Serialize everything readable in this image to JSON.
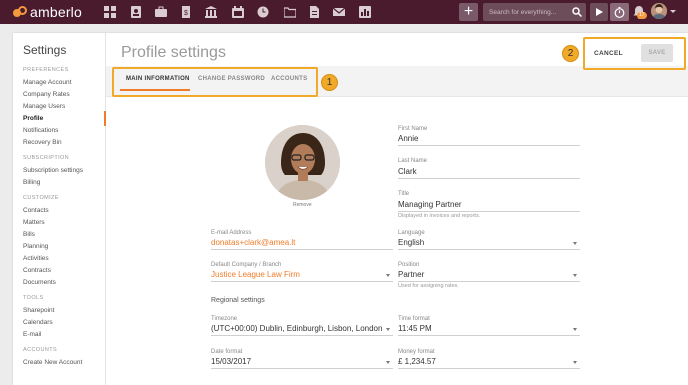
{
  "app": {
    "name": "amberlo"
  },
  "topbar": {
    "nav_icons": [
      "dashboard-icon",
      "contacts-icon",
      "matters-icon",
      "bills-icon",
      "bank-icon",
      "calendar-icon",
      "time-history-icon",
      "folder-icon",
      "documents-icon",
      "mail-icon",
      "reports-icon"
    ],
    "plus_label": "+",
    "search_placeholder": "Search for everything...",
    "notification_count": "17"
  },
  "sidebar": {
    "title": "Settings",
    "sections": [
      {
        "heading": "PREFERENCES",
        "items": [
          "Manage Account",
          "Company Rates",
          "Manage Users",
          "Profile",
          "Notifications",
          "Recovery Bin"
        ]
      },
      {
        "heading": "SUBSCRIPTION",
        "items": [
          "Subscription settings",
          "Billing"
        ]
      },
      {
        "heading": "CUSTOMIZE",
        "items": [
          "Contacts",
          "Matters",
          "Bills",
          "Planning",
          "Activities",
          "Contracts",
          "Documents"
        ]
      },
      {
        "heading": "TOOLS",
        "items": [
          "Sharepoint",
          "Calendars",
          "E-mail"
        ]
      },
      {
        "heading": "ACCOUNTS",
        "items": [
          "Create New Account"
        ]
      }
    ],
    "active_item": "Profile"
  },
  "header": {
    "title": "Profile settings",
    "cancel_label": "CANCEL",
    "save_label": "SAVE"
  },
  "tabs": [
    {
      "label": "MAIN INFORMATION",
      "active": true
    },
    {
      "label": "CHANGE PASSWORD",
      "active": false
    },
    {
      "label": "ACCOUNTS",
      "active": false
    }
  ],
  "callouts": [
    "1",
    "2"
  ],
  "profile": {
    "remove_label": "Remove",
    "first_name": {
      "label": "First Name",
      "value": "Annie"
    },
    "last_name": {
      "label": "Last Name",
      "value": "Clark"
    },
    "title": {
      "label": "Title",
      "value": "Managing Partner",
      "hint": "Displayed in invoices and reports."
    },
    "email": {
      "label": "E-mail Address",
      "value": "donatas+clark@amea.lt"
    },
    "language": {
      "label": "Language",
      "value": "English"
    },
    "default_company": {
      "label": "Default Company / Branch",
      "value": "Justice League Law Firm"
    },
    "position": {
      "label": "Position",
      "value": "Partner",
      "hint": "Used for assigning rates."
    }
  },
  "regional": {
    "heading": "Regional settings",
    "timezone": {
      "label": "Timezone",
      "value": "(UTC+00:00) Dublin, Edinburgh, Lisbon, London"
    },
    "time_format": {
      "label": "Time format",
      "value": "11:45 PM"
    },
    "date_format": {
      "label": "Date format",
      "value": "15/03/2017"
    },
    "money_format": {
      "label": "Money format",
      "value": "£ 1,234.57"
    }
  },
  "colors": {
    "topbar": "#4a1b2c",
    "accent": "#f07c2a",
    "callout": "#f0a928"
  }
}
